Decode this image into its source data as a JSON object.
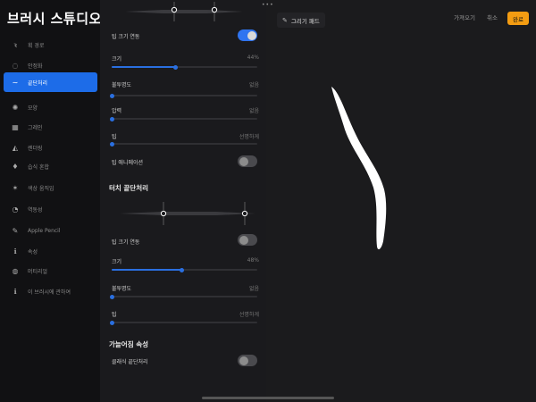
{
  "app_title": "브러시 스튜디오",
  "sidebar": {
    "items": [
      {
        "label": "획 경로",
        "icon": "stroke-path-icon",
        "glyph": "ꝛ"
      },
      {
        "label": "안정화",
        "icon": "stabilization-icon",
        "glyph": "◌"
      },
      {
        "label": "끝단처리",
        "icon": "taper-icon",
        "glyph": "∼",
        "active": true
      },
      {
        "label": "모양",
        "icon": "shape-icon",
        "glyph": "✺"
      },
      {
        "label": "그레인",
        "icon": "grain-icon",
        "glyph": "▦"
      },
      {
        "label": "렌더링",
        "icon": "rendering-icon",
        "glyph": "◭"
      },
      {
        "label": "습식 혼합",
        "icon": "wet-mix-icon",
        "glyph": "♦"
      },
      {
        "label": "색상 움직임",
        "icon": "color-dynamics-icon",
        "glyph": "✶"
      },
      {
        "label": "역동성",
        "icon": "dynamics-icon",
        "glyph": "◔"
      },
      {
        "label": "Apple Pencil",
        "icon": "apple-pencil-icon",
        "glyph": "✎"
      },
      {
        "label": "속성",
        "icon": "properties-icon",
        "glyph": "ℹ"
      },
      {
        "label": "머티리얼",
        "icon": "materials-icon",
        "glyph": "◍"
      },
      {
        "label": "이 브러시에 관하여",
        "icon": "about-icon",
        "glyph": "ℹ"
      }
    ]
  },
  "pencil_taper": {
    "tip_size_link_label": "팁 크기 연동",
    "tip_size_link_on": true,
    "size_label": "크기",
    "size_value": "44%",
    "size_fraction": 0.44,
    "opacity_label": "불투명도",
    "opacity_value": "없음",
    "opacity_fraction": 0.0,
    "pressure_label": "압력",
    "pressure_value": "없음",
    "pressure_fraction": 0.0,
    "tip_label": "팁",
    "tip_value": "선명하게",
    "tip_fraction": 0.0,
    "tip_animation_label": "팁 애니메이션",
    "tip_animation_on": false
  },
  "touch_taper": {
    "header": "터치 끝단처리",
    "tip_size_link_label": "팁 크기 연동",
    "tip_size_link_on": false,
    "size_label": "크기",
    "size_value": "48%",
    "size_fraction": 0.48,
    "opacity_label": "불투명도",
    "opacity_value": "없음",
    "opacity_fraction": 0.0,
    "tip_label": "팁",
    "tip_value": "선명하게",
    "tip_fraction": 0.0
  },
  "taper_properties": {
    "header": "가늘어짐 속성",
    "classic_label": "클래식 끝단처리",
    "classic_on": false
  },
  "topbar": {
    "drawing_pad_label": "그리기 패드",
    "import_label": "가져오기",
    "cancel_label": "취소",
    "done_label": "완료",
    "more_glyph": "•••"
  },
  "colors": {
    "accent": "#2a6fe0",
    "done": "#f39c12",
    "panel": "#1a1a1d",
    "sidebar": "#111113"
  }
}
